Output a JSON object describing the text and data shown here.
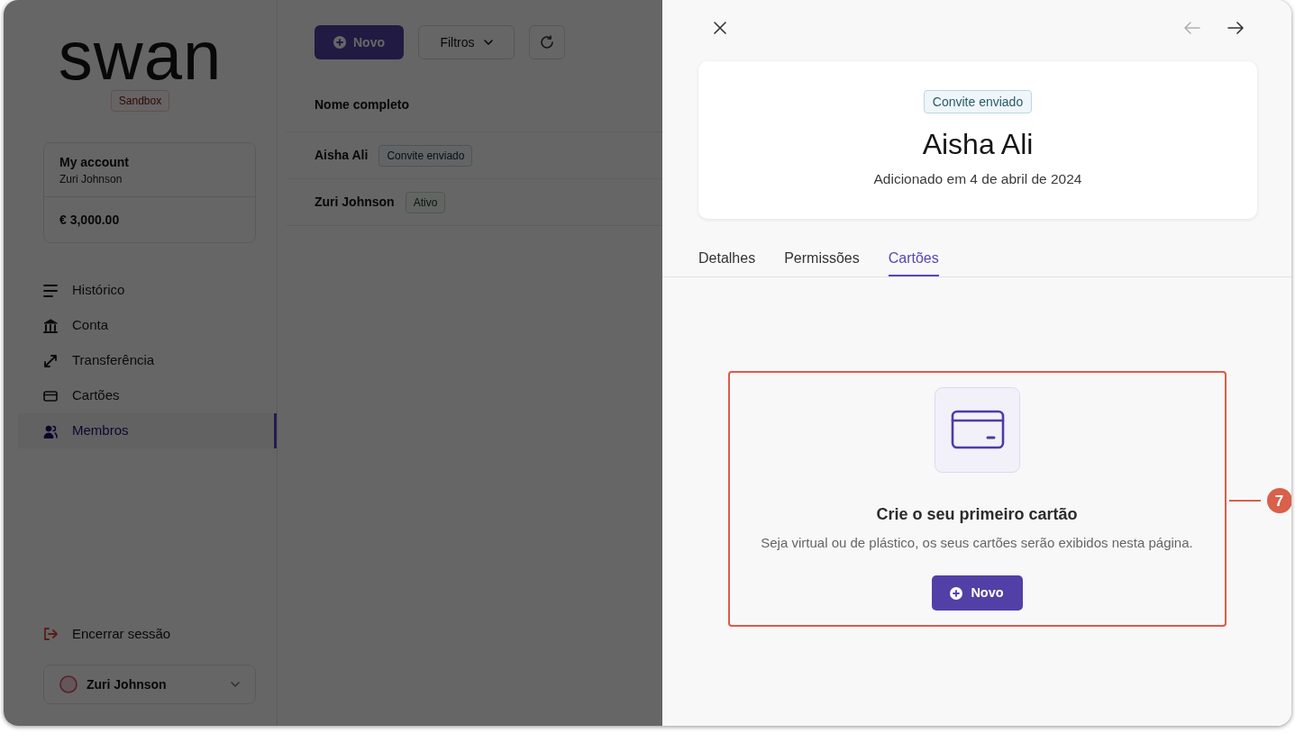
{
  "background_app": {
    "sidebar": {
      "logo": "swan",
      "environment": "Sandbox",
      "account": {
        "title": "My account",
        "holder": "Zuri Johnson",
        "balance": "€ 3,000.00"
      },
      "nav_items": [
        {
          "label": "Histórico",
          "selected": false
        },
        {
          "label": "Conta",
          "selected": false
        },
        {
          "label": "Transferência",
          "selected": false
        },
        {
          "label": "Cartões",
          "selected": false
        },
        {
          "label": "Membros",
          "selected": true
        }
      ],
      "logout": "Encerrar sessão",
      "user": {
        "name": "Zuri Johnson"
      }
    },
    "toolbar": {
      "new_button": "Novo",
      "filter_button": "Filtros"
    },
    "members_table": {
      "columns": [
        "Nome completo"
      ],
      "rows": [
        {
          "name": "Aisha Ali",
          "status": {
            "label": "Convite enviado",
            "kind": "invited"
          }
        },
        {
          "name": "Zuri Johnson",
          "status": {
            "label": "Ativo",
            "kind": "active"
          }
        }
      ]
    }
  },
  "detail_panel": {
    "navigation": {
      "previous": {
        "disabled": true
      },
      "next": {
        "disabled": false
      }
    },
    "member": {
      "status": {
        "label": "Convite enviado",
        "kind": "invited"
      },
      "name": "Aisha Ali",
      "added": "Adicionado em 4 de abril de 2024"
    },
    "tabs": [
      {
        "label": "Detalhes",
        "selected": false
      },
      {
        "label": "Permissões",
        "selected": false
      },
      {
        "label": "Cartões",
        "selected": true
      }
    ],
    "empty_state": {
      "title": "Crie o seu primeiro cartão",
      "description": "Seja virtual ou de plástico, os seus cartões serão exibidos nesta página.",
      "button": "Novo"
    },
    "annotation": {
      "number": "7"
    }
  }
}
